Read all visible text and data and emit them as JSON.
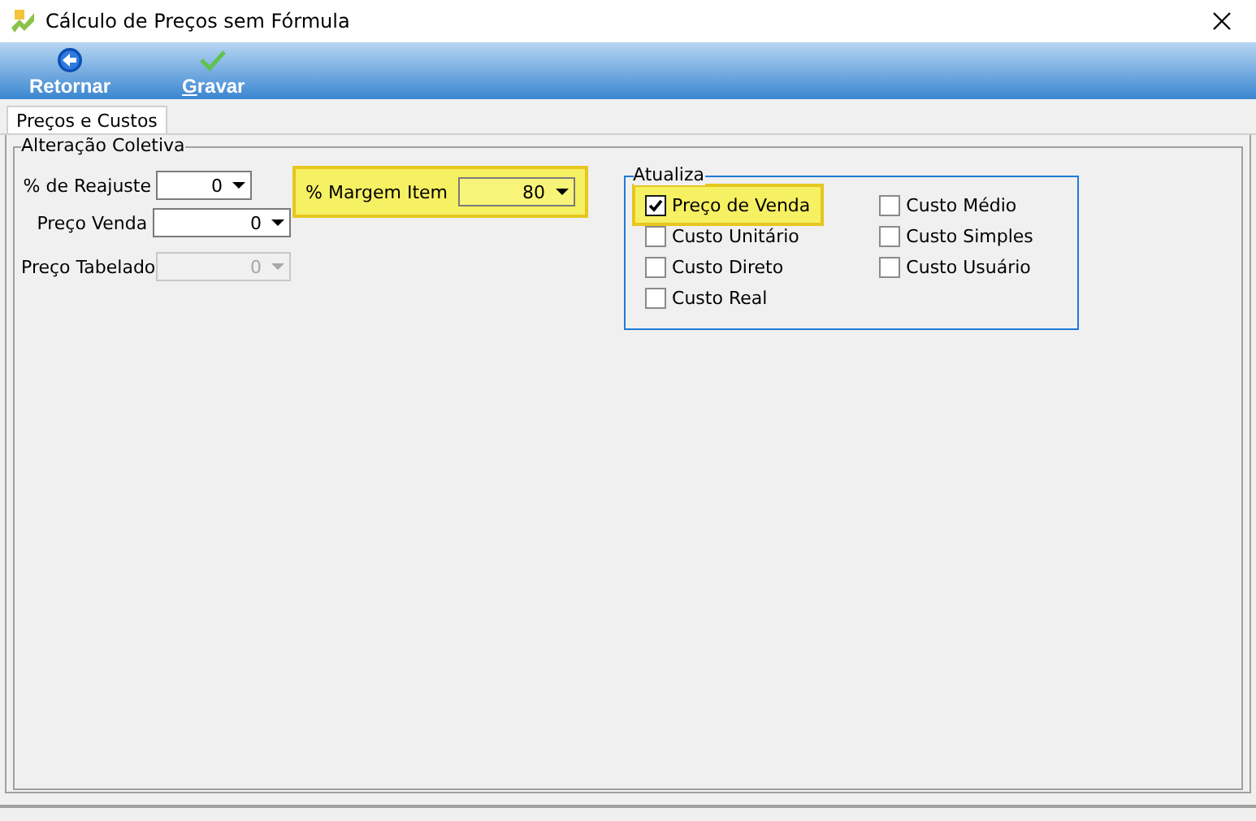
{
  "window": {
    "title": "Cálculo de Preços sem Fórmula"
  },
  "toolbar": [
    {
      "label": "Retornar",
      "kind": "back"
    },
    {
      "label": "G",
      "rest": "ravar",
      "kind": "save"
    }
  ],
  "tabs": [
    {
      "label": "Preços e Custos",
      "selected": true
    }
  ],
  "group": {
    "title": "Alteração Coletiva",
    "fields": [
      {
        "label": "% de Reajuste",
        "value": "0",
        "disabled": false
      },
      {
        "label": "Preço Venda",
        "value": "0",
        "disabled": false
      },
      {
        "label": "Preço Tabelado",
        "value": "0",
        "disabled": true
      }
    ],
    "margin": {
      "label": "% Margem Item",
      "value": "80",
      "highlighted": true
    },
    "update": {
      "title": "Atualiza",
      "columns": [
        [
          {
            "label": "Preço de Venda",
            "checked": true,
            "highlighted": true
          },
          {
            "label": "Custo Unitário",
            "checked": false,
            "highlighted": false
          },
          {
            "label": "Custo Direto",
            "checked": false,
            "highlighted": false
          },
          {
            "label": "Custo Real",
            "checked": false,
            "highlighted": false
          }
        ],
        [
          {
            "label": "Custo Médio",
            "checked": false,
            "highlighted": false
          },
          {
            "label": "Custo Simples",
            "checked": false,
            "highlighted": false
          },
          {
            "label": "Custo Usuário",
            "checked": false,
            "highlighted": false
          }
        ]
      ]
    }
  }
}
